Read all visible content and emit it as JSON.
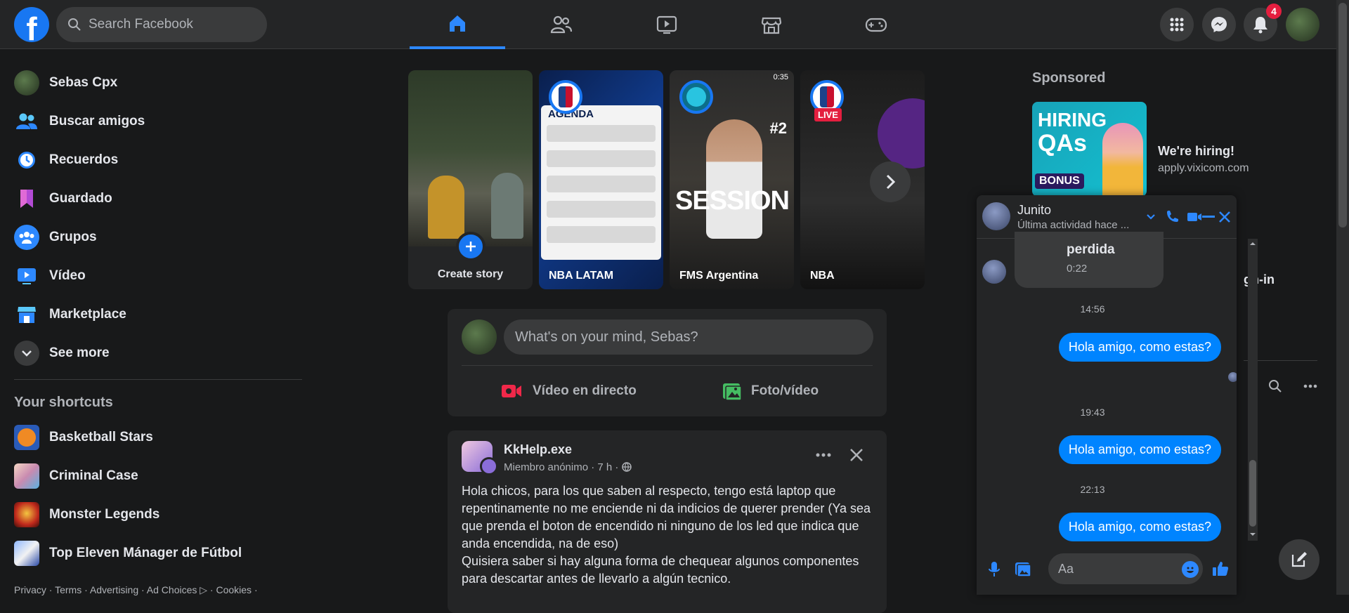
{
  "topbar": {
    "search_placeholder": "Search Facebook",
    "notification_count": "4"
  },
  "left_nav": {
    "profile_name": "Sebas Cpx",
    "items": [
      {
        "label": "Buscar amigos",
        "icon": "friends-icon"
      },
      {
        "label": "Recuerdos",
        "icon": "memories-icon"
      },
      {
        "label": "Guardado",
        "icon": "saved-icon"
      },
      {
        "label": "Grupos",
        "icon": "groups-icon"
      },
      {
        "label": "Vídeo",
        "icon": "video-icon"
      },
      {
        "label": "Marketplace",
        "icon": "marketplace-icon"
      }
    ],
    "see_more": "See more",
    "shortcuts_title": "Your shortcuts",
    "shortcuts": [
      {
        "label": "Basketball Stars"
      },
      {
        "label": "Criminal Case"
      },
      {
        "label": "Monster Legends"
      },
      {
        "label": "Top Eleven Mánager de Fútbol"
      }
    ],
    "footer": "Privacy · Terms · Advertising · Ad Choices ▷ · Cookies ·"
  },
  "stories": {
    "create_label": "Create story",
    "items": [
      {
        "label": "NBA LATAM",
        "overlay": "AGENDA"
      },
      {
        "label": "FMS Argentina",
        "overlay": "SESSION",
        "badge": "#2",
        "duration": "0:35"
      },
      {
        "label": "NBA",
        "overlay": "LIVE"
      }
    ]
  },
  "composer": {
    "placeholder": "What's on your mind, Sebas?",
    "live_label": "Vídeo en directo",
    "photo_label": "Foto/vídeo"
  },
  "post": {
    "author": "KkHelp.exe",
    "meta": "Miembro anónimo · 7 h · ",
    "text": "Hola chicos, para los que saben al respecto, tengo está laptop que repentinamente no me enciende ni da indicios de querer prender (Ya sea que prenda el boton de encendido ni ninguno de los led que indica que anda encendida, na de eso)\nQuisiera saber si hay alguna forma de chequear algunos componentes para descartar antes de llevarlo a algún tecnico."
  },
  "sponsored": {
    "title": "Sponsored",
    "ad_title": "We're hiring!",
    "ad_url": "apply.vixicom.com",
    "ad_headline": "HIRING",
    "ad_subline": "QAs",
    "ad_bonus": "BONUS",
    "peek_text": "gn-in"
  },
  "chat": {
    "name": "Junito",
    "status": "Última actividad hace ...",
    "missed_call_text": "perdida",
    "missed_call_duration": "0:22",
    "messages": [
      {
        "time": "14:56",
        "text": "Hola amigo, como estas?"
      },
      {
        "time": "19:43",
        "text": "Hola amigo, como estas?"
      },
      {
        "time": "22:13",
        "text": "Hola amigo, como estas?"
      }
    ],
    "input_placeholder": "Aa"
  }
}
